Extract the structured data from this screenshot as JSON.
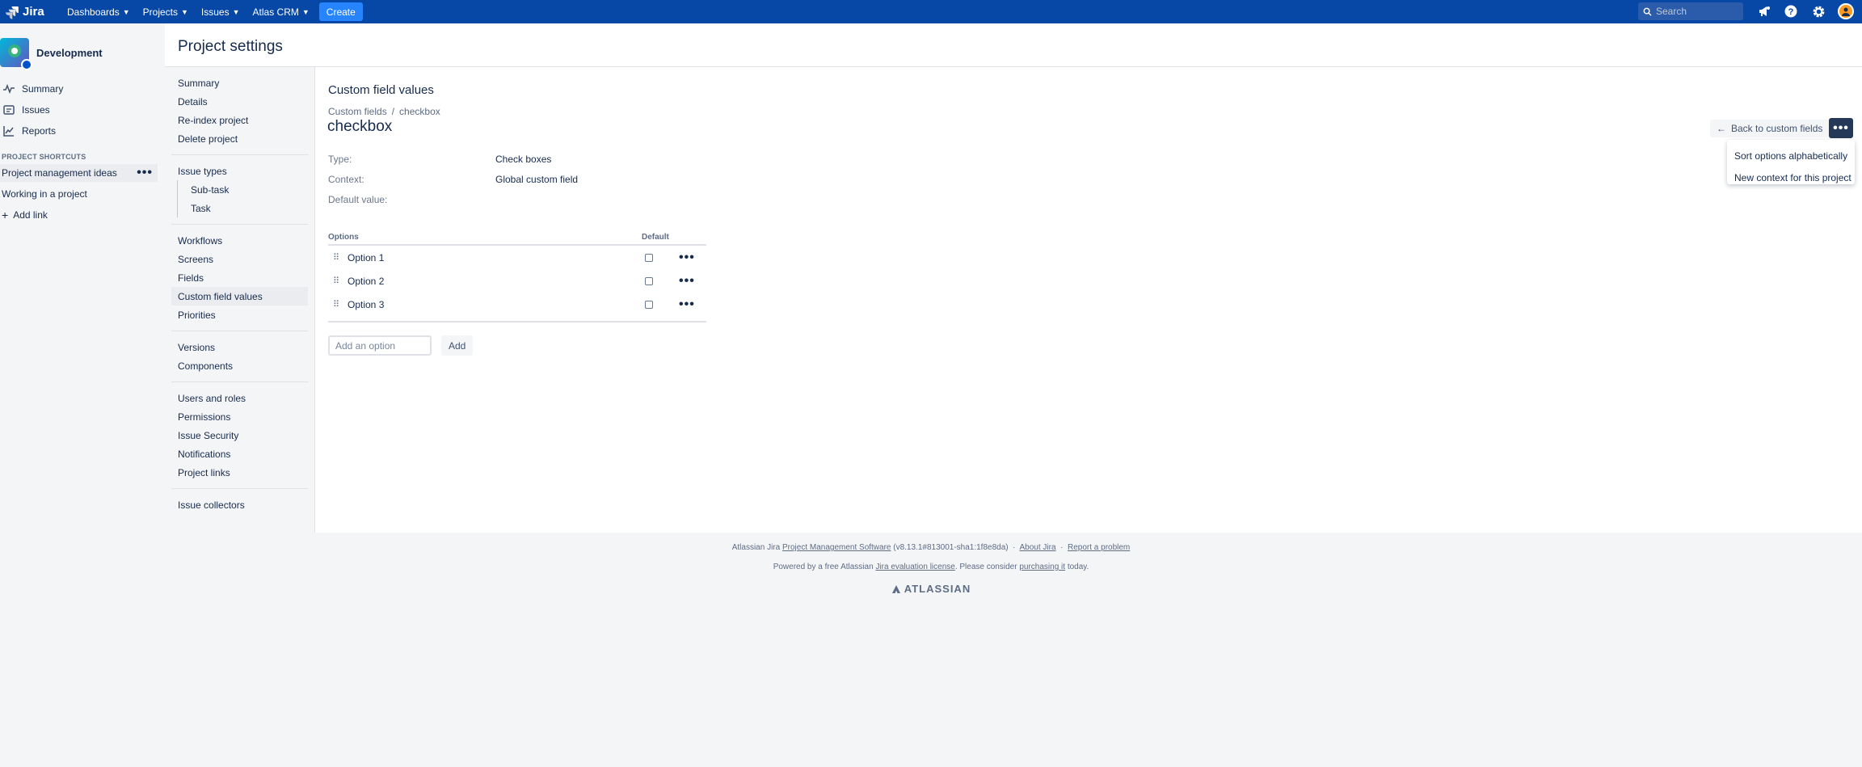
{
  "topbar": {
    "logo_text": "Jira",
    "nav": [
      {
        "label": "Dashboards"
      },
      {
        "label": "Projects"
      },
      {
        "label": "Issues"
      },
      {
        "label": "Atlas CRM"
      }
    ],
    "create_label": "Create",
    "search_placeholder": "Search",
    "colors": {
      "bar": "#0747a6",
      "create": "#2684ff"
    }
  },
  "project": {
    "name": "Development",
    "nav": [
      {
        "label": "Summary",
        "icon": "pulse-icon"
      },
      {
        "label": "Issues",
        "icon": "issues-icon"
      },
      {
        "label": "Reports",
        "icon": "chart-icon"
      }
    ],
    "shortcuts_title": "PROJECT SHORTCUTS",
    "shortcuts": [
      {
        "label": "Project management ideas"
      },
      {
        "label": "Working in a project"
      }
    ],
    "add_link_label": "Add link"
  },
  "settings": {
    "title": "Project settings",
    "nav_groups": [
      [
        {
          "label": "Summary"
        },
        {
          "label": "Details"
        },
        {
          "label": "Re-index project"
        },
        {
          "label": "Delete project"
        }
      ],
      [
        {
          "label": "Issue types"
        },
        {
          "label": "Sub-task"
        },
        {
          "label": "Task"
        }
      ],
      [
        {
          "label": "Workflows"
        },
        {
          "label": "Screens"
        },
        {
          "label": "Fields"
        },
        {
          "label": "Custom field values"
        },
        {
          "label": "Priorities"
        }
      ],
      [
        {
          "label": "Versions"
        },
        {
          "label": "Components"
        }
      ],
      [
        {
          "label": "Users and roles"
        },
        {
          "label": "Permissions"
        },
        {
          "label": "Issue Security"
        },
        {
          "label": "Notifications"
        },
        {
          "label": "Project links"
        }
      ],
      [
        {
          "label": "Issue collectors"
        }
      ]
    ]
  },
  "main": {
    "section_title": "Custom field values",
    "breadcrumb": [
      "Custom fields",
      "checkbox"
    ],
    "breadcrumb_sep": "/",
    "field_title": "checkbox",
    "meta": [
      {
        "key": "Type:",
        "value": "Check boxes"
      },
      {
        "key": "Context:",
        "value": "Global custom field"
      },
      {
        "key": "Default value:",
        "value": ""
      }
    ],
    "table": {
      "col_options": "Options",
      "col_default": "Default",
      "rows": [
        {
          "label": "Option 1"
        },
        {
          "label": "Option 2"
        },
        {
          "label": "Option 3"
        }
      ]
    },
    "add_placeholder": "Add an option",
    "add_label": "Add",
    "back_label": "Back to custom fields",
    "menu": [
      {
        "label": "Sort options alphabetically"
      },
      {
        "label": "New context for this project"
      }
    ]
  },
  "footer": {
    "line1_prefix": "Atlassian Jira",
    "line1_link": "Project Management Software",
    "line1_version": "(v8.13.1#813001-sha1:1f8e8da)",
    "about": "About Jira",
    "report": "Report a problem",
    "line2_a": "Powered by a free Atlassian",
    "line2_link1": "Jira evaluation license",
    "line2_b": ". Please consider",
    "line2_link2": "purchasing it",
    "line2_c": "today.",
    "brand": "ATLASSIAN"
  }
}
